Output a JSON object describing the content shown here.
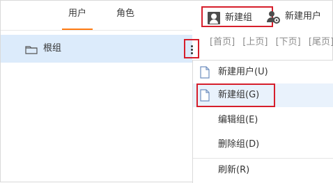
{
  "tabs": {
    "users": "用户",
    "roles": "角色"
  },
  "toolbar": {
    "new_group": "新建组",
    "new_user": "新建用户"
  },
  "tree": {
    "root_group": "根组"
  },
  "pager": {
    "first": "[首页]",
    "previous": "[上页]",
    "next": "[下页]",
    "last": "[尾页]"
  },
  "context_menu": {
    "new_user": "新建用户(U)",
    "new_group": "新建组(G)",
    "edit_group": "编辑组(E)",
    "delete_group": "删除组(D)",
    "refresh": "刷新(R)"
  },
  "colors": {
    "accent_tab": "#ff7a12",
    "highlight": "#d61e2b",
    "selected_row": "#dcebfb",
    "menu_active": "#e9f2fc"
  },
  "icons": {
    "new_group": "user-icon",
    "new_user": "user-gear-icon",
    "root_group": "folder-icon",
    "menu_new_user": "document-icon",
    "menu_new_group": "document-icon"
  }
}
